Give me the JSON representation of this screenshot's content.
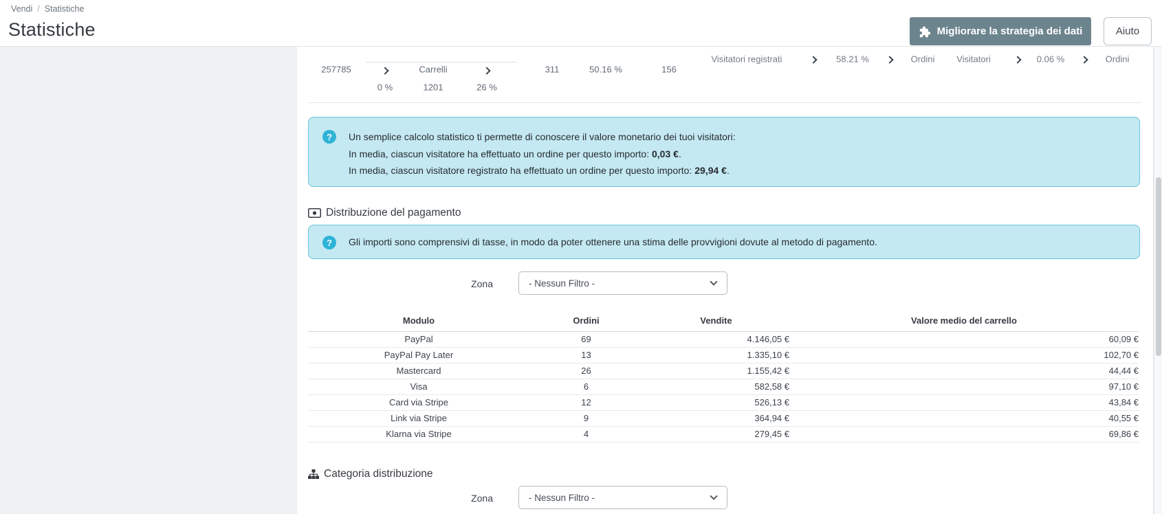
{
  "breadcrumb": {
    "section": "Vendi",
    "separator": "/",
    "page": "Statistiche"
  },
  "header": {
    "title": "Statistiche",
    "improve_button_label": "Migliorare la strategia dei dati",
    "help_button_label": "Aiuto"
  },
  "funnel": {
    "visitors_count": "257785",
    "visitors_to_carts_rate": "0 %",
    "carts_label": "Carrelli",
    "carts_count": "1201",
    "carts_to_orders_rate": "26 %",
    "orders_count": "311",
    "valid_orders_rate": "50.16 %",
    "registered_orders_count": "156",
    "registered_visitors_label": "Visitatori registrati",
    "registered_conversion_rate": "58.21 %",
    "orders_label_1": "Ordini",
    "visitors_label": "Visitatori",
    "visitor_conversion_rate": "0.06 %",
    "orders_label_2": "Ordini"
  },
  "visitor_value_info": {
    "line1": "Un semplice calcolo statistico ti permette di conoscere il valore monetario dei tuoi visitatori:",
    "line2_text": "In media, ciascun visitatore ha effettuato un ordine per questo importo: ",
    "line2_value": "0,03 €",
    "line2_end": ".",
    "line3_text": "In media, ciascun visitatore registrato ha effettuato un ordine per questo importo: ",
    "line3_value": "29,94 €",
    "line3_end": "."
  },
  "payment_section": {
    "title": "Distribuzione del pagamento",
    "info": "Gli importi sono comprensivi di tasse, in modo da poter ottenere una stima delle provvigioni dovute al metodo di pagamento.",
    "zone_label": "Zona",
    "zone_selected": "- Nessun Filtro -",
    "table": {
      "headers": [
        "Modulo",
        "Ordini",
        "Vendite",
        "Valore medio del carrello"
      ],
      "rows": [
        [
          "PayPal",
          "69",
          "4.146,05 €",
          "60,09 €"
        ],
        [
          "PayPal Pay Later",
          "13",
          "1.335,10 €",
          "102,70 €"
        ],
        [
          "Mastercard",
          "26",
          "1.155,42 €",
          "44,44 €"
        ],
        [
          "Visa",
          "6",
          "582,58 €",
          "97,10 €"
        ],
        [
          "Card via Stripe",
          "12",
          "526,13 €",
          "43,84 €"
        ],
        [
          "Link via Stripe",
          "9",
          "364,94 €",
          "40,55 €"
        ],
        [
          "Klarna via Stripe",
          "4",
          "279,45 €",
          "69,86 €"
        ]
      ]
    }
  },
  "category_section": {
    "title": "Categoria distribuzione",
    "zone_label": "Zona",
    "zone_selected": "- Nessun Filtro -"
  },
  "icons": {
    "info": "?",
    "improve_button": "puzzle-piece",
    "payment_section": "banknote",
    "category_section": "sitemap",
    "funnel_step": "chevron-right",
    "zone_select": "chevron-down"
  },
  "colors": {
    "accent_info": "#2eb3d6",
    "info_box_bg": "#c5e9f2",
    "info_box_border": "#65c4da",
    "improve_button_bg": "#6c848e",
    "page_bg": "#eef0f1"
  }
}
